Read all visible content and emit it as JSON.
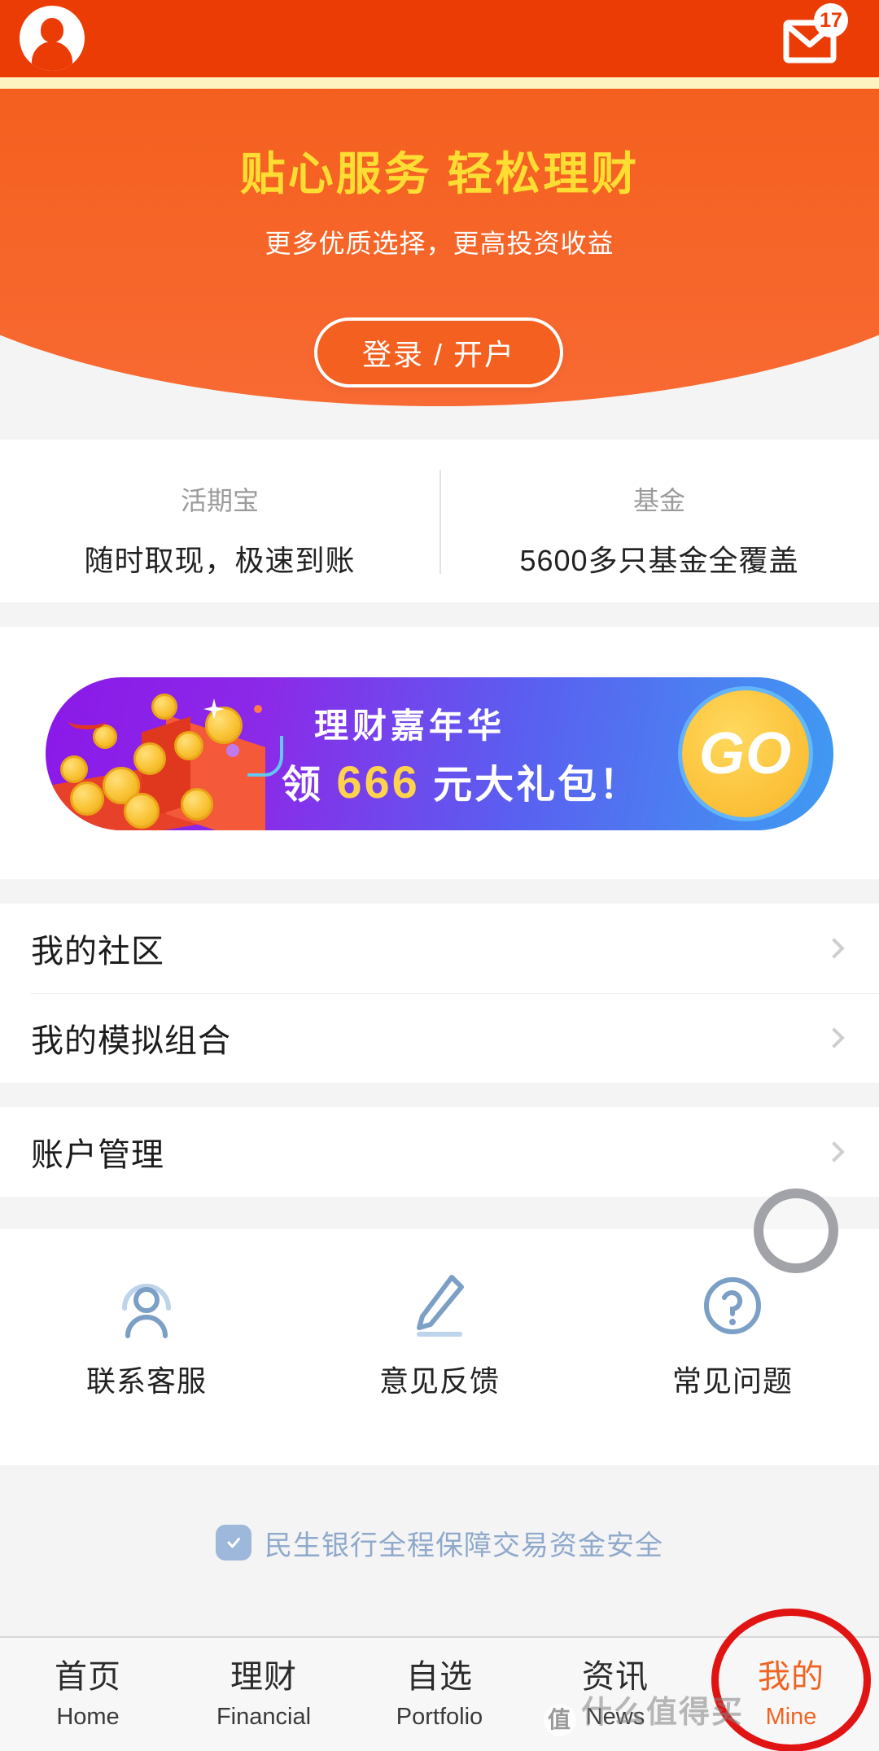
{
  "topbar": {
    "avatar_name": "avatar",
    "mail_icon": "mail-icon",
    "badge_count": "17"
  },
  "hero": {
    "title": "贴心服务 轻松理财",
    "subtitle": "更多优质选择，更高投资收益",
    "login_button": "登录 / 开户",
    "bg_color": "#f4601f",
    "title_color": "#ffdd33"
  },
  "stats": [
    {
      "title": "活期宝",
      "desc": "随时取现，极速到账"
    },
    {
      "title": "基金",
      "desc": "5600多只基金全覆盖"
    }
  ],
  "banner": {
    "line1": "理财嘉年华",
    "line2_prefix": "领 ",
    "line2_amount": "666",
    "line2_suffix": " 元大礼包！",
    "go_label": "GO",
    "gradient_from": "#8b19e8",
    "gradient_to": "#3f9bf2",
    "go_color": "#fcc33c"
  },
  "menu": {
    "group1": [
      {
        "label": "我的社区"
      },
      {
        "label": "我的模拟组合"
      }
    ],
    "group2": [
      {
        "label": "账户管理"
      }
    ]
  },
  "services": [
    {
      "label": "联系客服",
      "icon": "customer-service-icon"
    },
    {
      "label": "意见反馈",
      "icon": "pencil-icon"
    },
    {
      "label": "常见问题",
      "icon": "question-mark-icon"
    }
  ],
  "security": {
    "text": "民生银行全程保障交易资金安全",
    "icon": "shield-check-icon",
    "color": "#8fa9cc"
  },
  "bottom_nav": {
    "active_index": 4,
    "items": [
      {
        "cn": "首页",
        "en": "Home"
      },
      {
        "cn": "理财",
        "en": "Financial"
      },
      {
        "cn": "自选",
        "en": "Portfolio"
      },
      {
        "cn": "资讯",
        "en": "News"
      },
      {
        "cn": "我的",
        "en": "Mine"
      }
    ],
    "active_color": "#ef6422"
  },
  "overlays": {
    "assistive_touch": "assistive-touch-button",
    "annotation_color": "#e11414",
    "watermark": "什么值得买",
    "watermark_logo": "值"
  }
}
